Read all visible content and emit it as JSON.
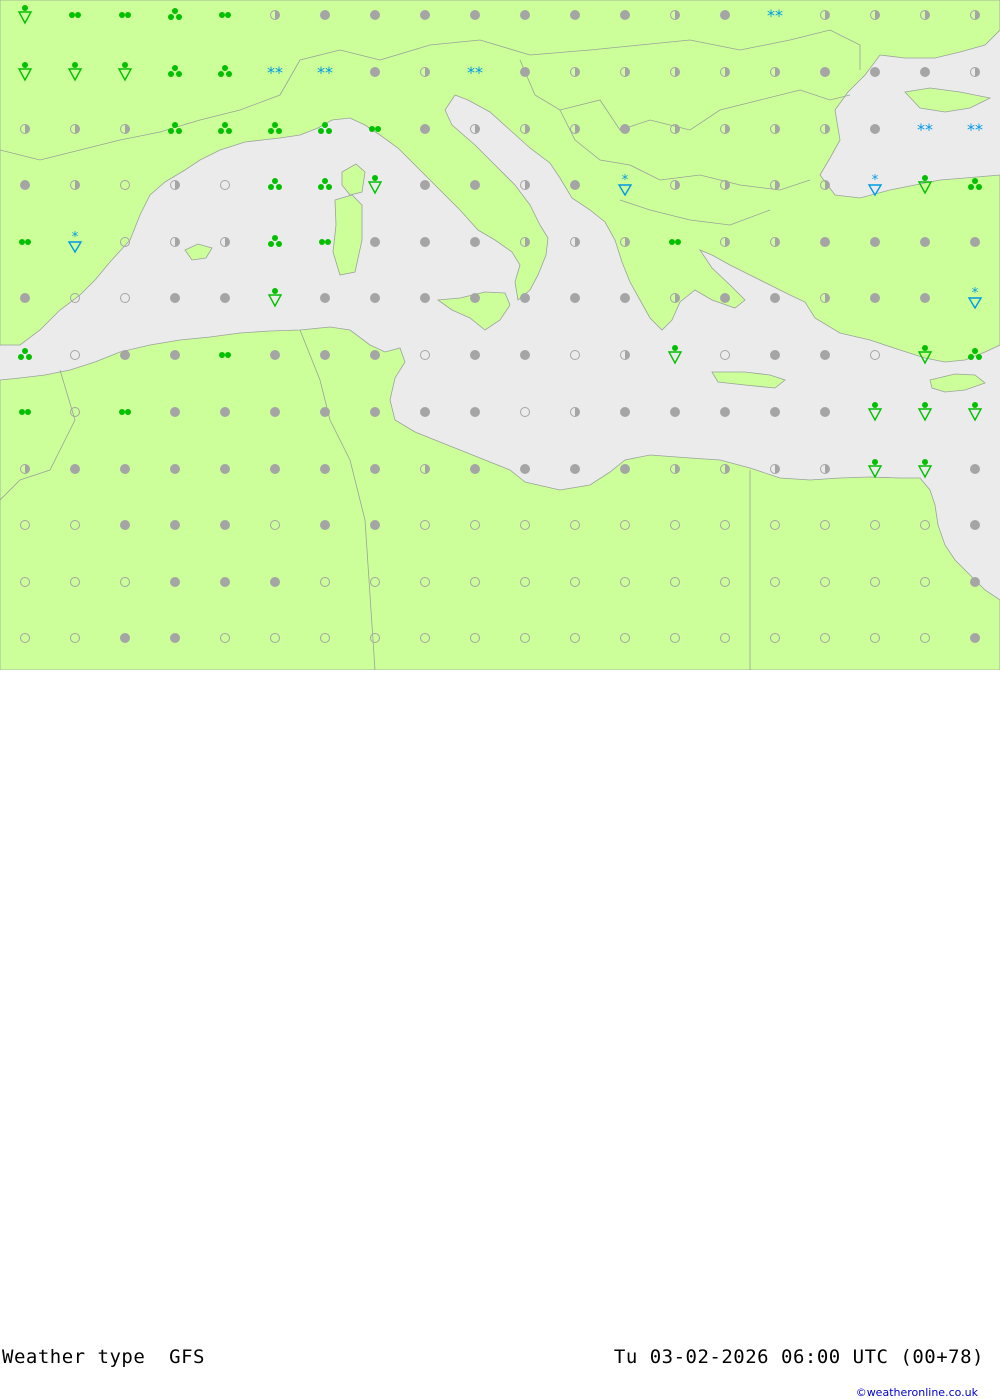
{
  "map": {
    "colors": {
      "sea": "#ebebeb",
      "land": "#ccff99",
      "border": "#9aa39a",
      "cloud_gray": "#a5a5a5",
      "rain_green": "#00c000",
      "snow_blue": "#0099e6"
    },
    "legend_symbols": [
      "clear",
      "partly-cloudy",
      "cloudy",
      "light-rain",
      "rain",
      "rain-showers",
      "heavy-showers",
      "snow",
      "snow-showers"
    ]
  },
  "footer": {
    "title": "Weather type  GFS",
    "datetime": "Tu 03-02-2026 06:00 UTC (00+78)",
    "credit": "©weatheronline.co.uk"
  }
}
